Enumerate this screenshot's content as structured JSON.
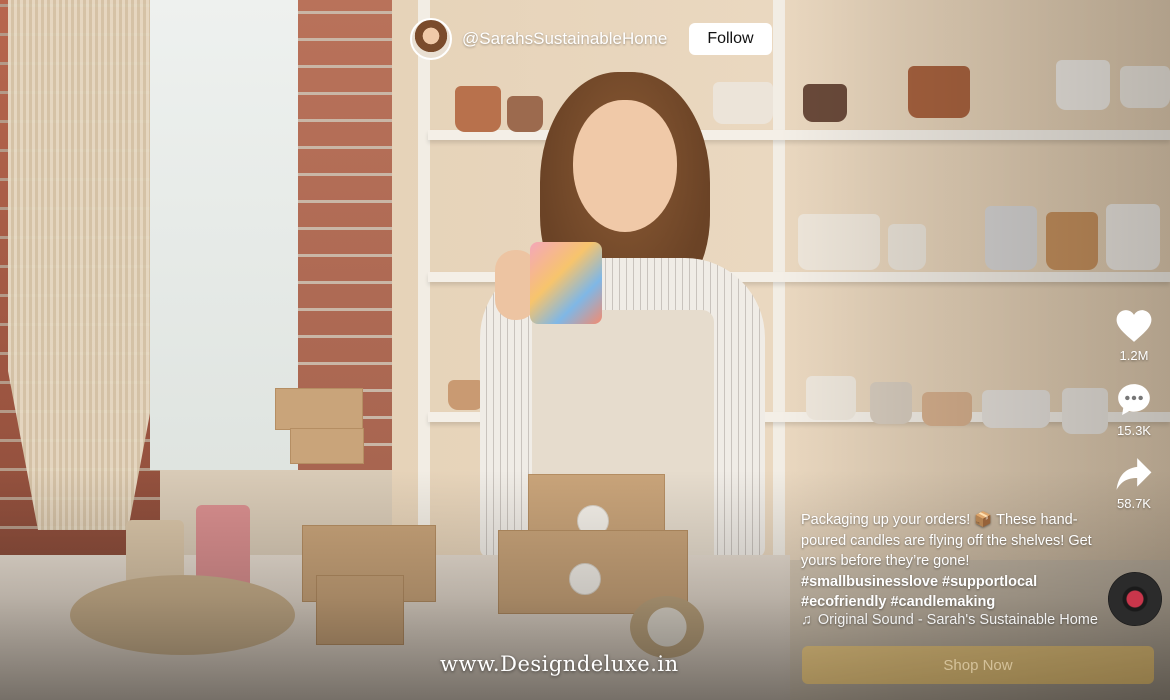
{
  "profile": {
    "handle": "@SarahsSustainableHome",
    "follow_label": "Follow"
  },
  "actions": {
    "like": {
      "icon": "heart-icon",
      "count": "1.2M"
    },
    "comment": {
      "icon": "comment-icon",
      "count": "15.3K"
    },
    "share": {
      "icon": "share-icon",
      "count": "58.7K"
    }
  },
  "caption": {
    "line1": "Packaging up your orders! 📦 These hand-poured candles are flying off the shelves! Get yours before they’re gone! ",
    "tags": "#smallbusinesslove #supportlocal #ecofriendly #candlemaking"
  },
  "sound": {
    "icon": "music-note-icon",
    "label": "Original Sound - Sarah's Sustainable Home"
  },
  "shop_label": "Shop Now",
  "watermark": "www.Designdeluxe.in",
  "colors": {
    "follow_bg": "#ffffff",
    "shop_accent": "#ffbe28",
    "record_label": "#c9364b"
  }
}
